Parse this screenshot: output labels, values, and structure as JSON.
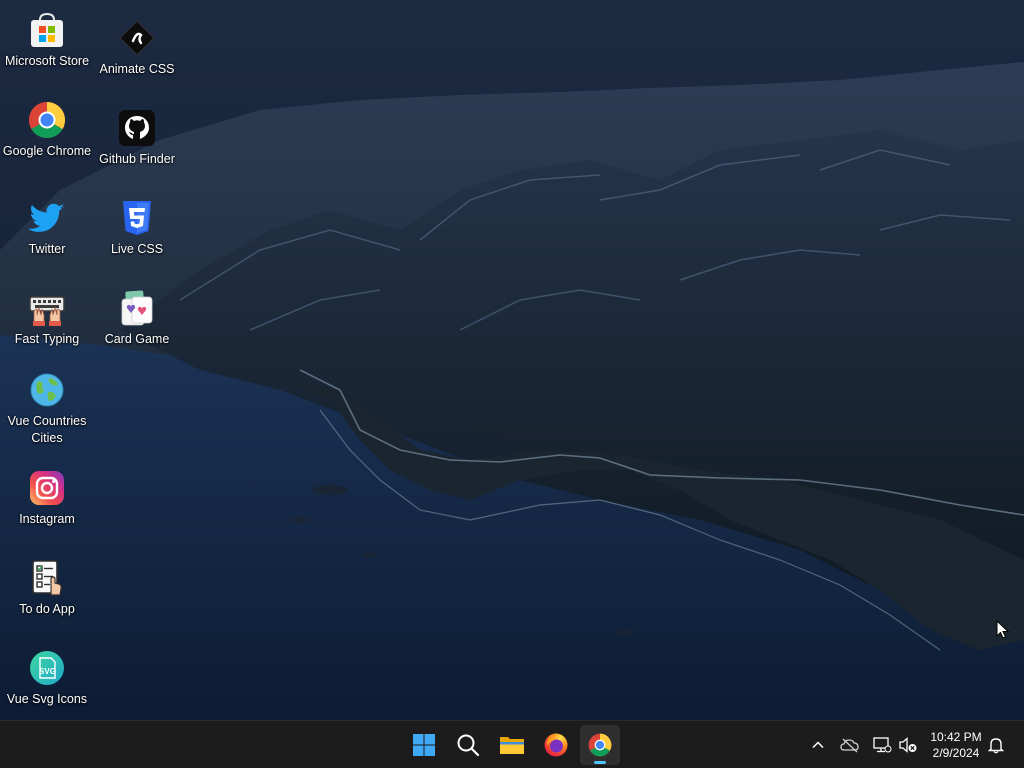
{
  "desktop": {
    "icons": [
      {
        "label": "Microsoft Store",
        "icon": "microsoft-store-icon"
      },
      {
        "label": "Animate CSS",
        "icon": "animate-css-icon"
      },
      {
        "label": "Google Chrome",
        "icon": "google-chrome-icon"
      },
      {
        "label": "Github Finder",
        "icon": "github-icon"
      },
      {
        "label": "Twitter",
        "icon": "twitter-icon"
      },
      {
        "label": "Live CSS",
        "icon": "css3-icon"
      },
      {
        "label": "Fast Typing",
        "icon": "keyboard-hands-icon"
      },
      {
        "label": "Card Game",
        "icon": "card-game-icon"
      },
      {
        "label": "Vue Countries Cities",
        "icon": "globe-icon"
      },
      {
        "label": "Instagram",
        "icon": "instagram-icon"
      },
      {
        "label": "To do App",
        "icon": "todo-list-icon"
      },
      {
        "label": "Vue Svg Icons",
        "icon": "svg-icon"
      }
    ]
  },
  "taskbar": {
    "apps": [
      {
        "name": "Start",
        "icon": "windows-start-icon",
        "active": false
      },
      {
        "name": "Search",
        "icon": "search-icon",
        "active": false
      },
      {
        "name": "File Explorer",
        "icon": "folder-icon",
        "active": false
      },
      {
        "name": "Firefox",
        "icon": "firefox-icon",
        "active": false
      },
      {
        "name": "Google Chrome",
        "icon": "google-chrome-icon",
        "active": true
      }
    ],
    "tray": {
      "icons": [
        "chevron-up-icon",
        "onedrive-offline-icon",
        "network-icon",
        "volume-muted-icon"
      ],
      "time": "10:42 PM",
      "date": "2/9/2024",
      "notification_icon": "bell-icon"
    }
  },
  "colors": {
    "taskbar_bg": "#1c1c1c",
    "accent": "#4cc2ff"
  }
}
